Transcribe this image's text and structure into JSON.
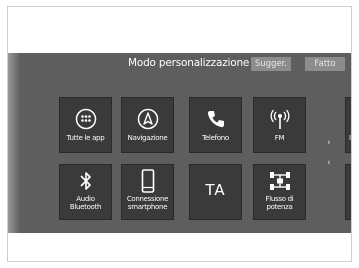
{
  "header": {
    "title": "Modo personalizzazione",
    "suggest_label": "Sugger.",
    "done_label": "Fatto"
  },
  "tiles": {
    "all_apps": "Tutte le app",
    "navigation": "Navigazione",
    "phone": "Telefono",
    "fm": "FM",
    "bt_audio_1": "Audio",
    "bt_audio_2": "Bluetooth",
    "smartphone_1": "Connessione",
    "smartphone_2": "smartphone",
    "ta": "TA",
    "power_1": "Flusso di",
    "power_2": "potenza",
    "partial_top": "Im"
  },
  "chevrons": {
    "up": "‹",
    "down": "‹"
  }
}
